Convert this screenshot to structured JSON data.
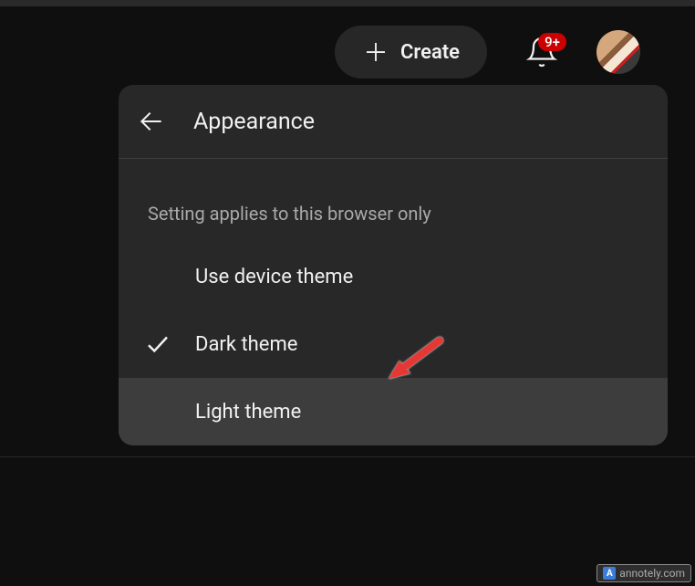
{
  "header": {
    "create_label": "Create",
    "notification_badge": "9+"
  },
  "popup": {
    "title": "Appearance",
    "hint": "Setting applies to this browser only",
    "options": [
      {
        "label": "Use device theme",
        "selected": false
      },
      {
        "label": "Dark theme",
        "selected": true
      },
      {
        "label": "Light theme",
        "selected": false
      }
    ]
  },
  "watermark": {
    "logo_letter": "A",
    "text": "annotely.com"
  }
}
